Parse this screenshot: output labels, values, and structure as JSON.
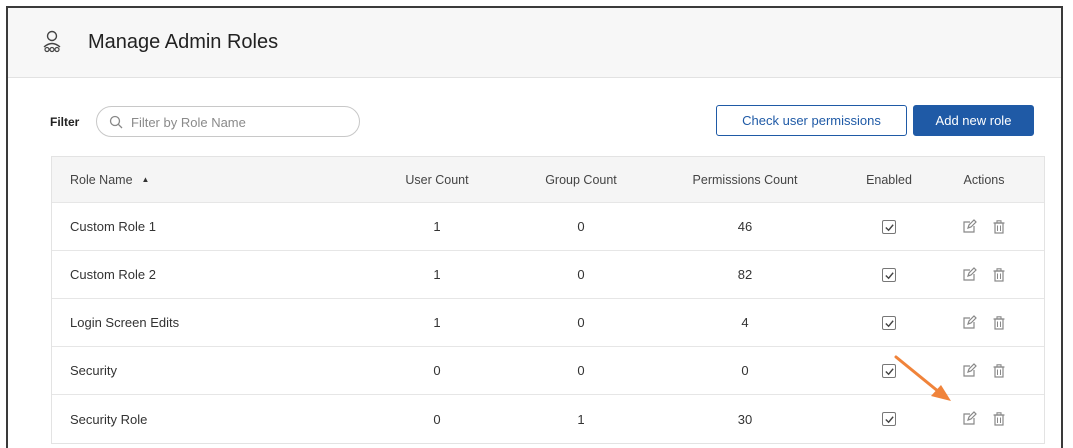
{
  "header": {
    "title": "Manage Admin Roles",
    "icon": "user-group-icon"
  },
  "filter": {
    "label": "Filter",
    "placeholder": "Filter by Role Name",
    "value": ""
  },
  "buttons": {
    "check_permissions": "Check user permissions",
    "add_role": "Add new role"
  },
  "colors": {
    "primary": "#1f5aa6",
    "annotation_arrow": "#f0833a"
  },
  "table": {
    "columns": {
      "role_name": "Role Name",
      "user_count": "User Count",
      "group_count": "Group Count",
      "permissions_count": "Permissions Count",
      "enabled": "Enabled",
      "actions": "Actions"
    },
    "sort": {
      "column": "role_name",
      "direction": "ascending"
    },
    "rows": [
      {
        "name": "Custom Role 1",
        "users": "1",
        "groups": "0",
        "permissions": "46",
        "enabled": true
      },
      {
        "name": "Custom Role 2",
        "users": "1",
        "groups": "0",
        "permissions": "82",
        "enabled": true
      },
      {
        "name": "Login Screen Edits",
        "users": "1",
        "groups": "0",
        "permissions": "4",
        "enabled": true
      },
      {
        "name": "Security",
        "users": "0",
        "groups": "0",
        "permissions": "0",
        "enabled": true
      },
      {
        "name": "Security Role",
        "users": "0",
        "groups": "1",
        "permissions": "30",
        "enabled": true
      }
    ]
  },
  "annotation": {
    "type": "arrow",
    "target": "edit-icon of Security Role row"
  }
}
